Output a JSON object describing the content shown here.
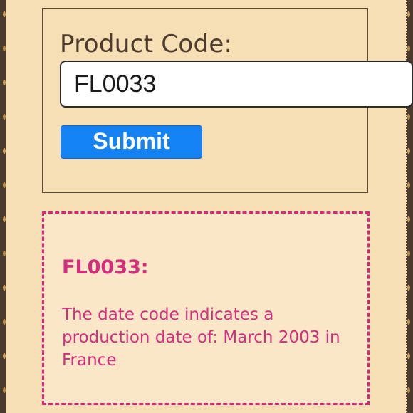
{
  "form": {
    "label": "Product Code:",
    "input_value": "FL0033",
    "submit_label": "Submit"
  },
  "result": {
    "code": "FL0033:",
    "message": "The date code indicates a production date of: March 2003 in France"
  },
  "colors": {
    "page_background": "#f7dfb5",
    "result_background": "#fbe6c8",
    "accent_pink": "#d42d7c",
    "button_blue": "#1482f2",
    "label_brown": "#4d3b2d"
  }
}
